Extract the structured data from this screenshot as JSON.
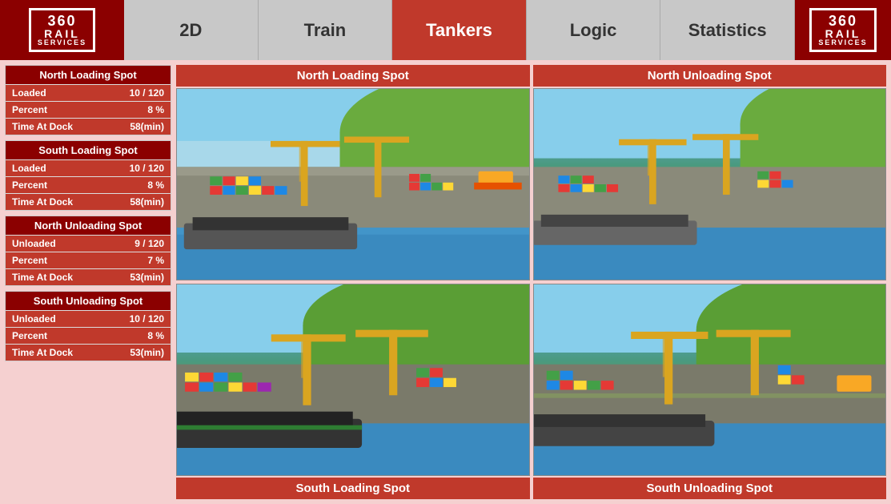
{
  "app": {
    "title": "360 Rail Services"
  },
  "nav": {
    "logo_line1": "360",
    "logo_line2": "RAIL",
    "logo_line3": "SERVICES",
    "tabs": [
      {
        "id": "2d",
        "label": "2D",
        "active": false
      },
      {
        "id": "train",
        "label": "Train",
        "active": false
      },
      {
        "id": "tankers",
        "label": "Tankers",
        "active": true
      },
      {
        "id": "logic",
        "label": "Logic",
        "active": false
      },
      {
        "id": "statistics",
        "label": "Statistics",
        "active": false
      }
    ]
  },
  "stats": {
    "groups": [
      {
        "id": "north-loading",
        "title": "North Loading Spot",
        "rows": [
          {
            "label": "Loaded",
            "value": "10 / 120"
          },
          {
            "label": "Percent",
            "value": "8 %"
          },
          {
            "label": "Time At Dock",
            "value": "58(min)"
          }
        ]
      },
      {
        "id": "south-loading",
        "title": "South Loading Spot",
        "rows": [
          {
            "label": "Loaded",
            "value": "10 / 120"
          },
          {
            "label": "Percent",
            "value": "8 %"
          },
          {
            "label": "Time At Dock",
            "value": "58(min)"
          }
        ]
      },
      {
        "id": "north-unloading",
        "title": "North Unloading Spot",
        "rows": [
          {
            "label": "Unloaded",
            "value": "9 / 120"
          },
          {
            "label": "Percent",
            "value": "7 %"
          },
          {
            "label": "Time At Dock",
            "value": "53(min)"
          }
        ]
      },
      {
        "id": "south-unloading",
        "title": "South Unloading Spot",
        "rows": [
          {
            "label": "Unloaded",
            "value": "10 / 120"
          },
          {
            "label": "Percent",
            "value": "8 %"
          },
          {
            "label": "Time At Dock",
            "value": "53(min)"
          }
        ]
      }
    ]
  },
  "viewports": {
    "top_left_label": "North Loading Spot",
    "top_right_label": "North Unloading Spot",
    "bottom_left_label": "South Loading Spot",
    "bottom_right_label": "South Unloading Spot"
  }
}
